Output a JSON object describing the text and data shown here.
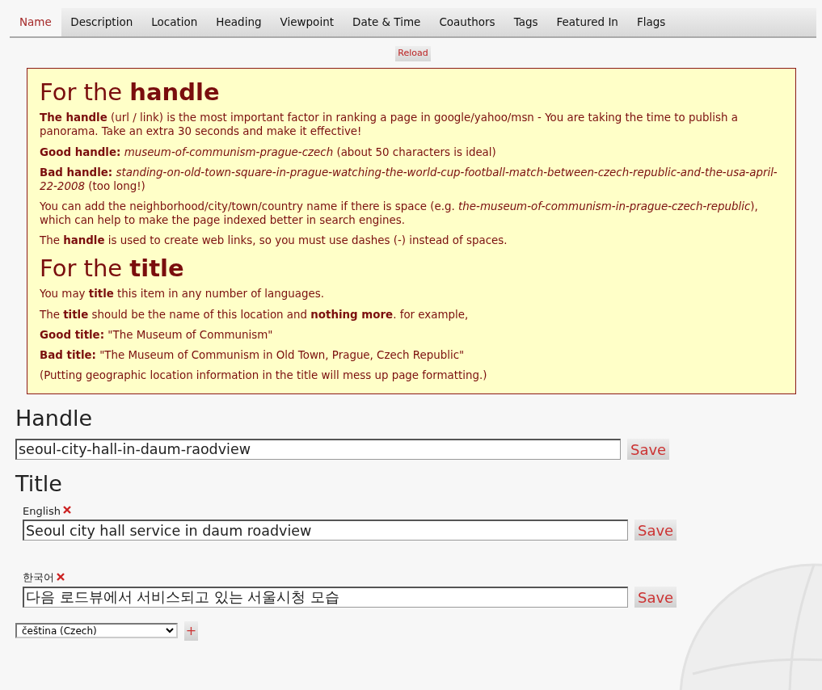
{
  "tabs": [
    {
      "label": "Name",
      "selected": true
    },
    {
      "label": "Description",
      "selected": false
    },
    {
      "label": "Location",
      "selected": false
    },
    {
      "label": "Heading",
      "selected": false
    },
    {
      "label": "Viewpoint",
      "selected": false
    },
    {
      "label": "Date & Time",
      "selected": false
    },
    {
      "label": "Coauthors",
      "selected": false
    },
    {
      "label": "Tags",
      "selected": false
    },
    {
      "label": "Featured In",
      "selected": false
    },
    {
      "label": "Flags",
      "selected": false
    }
  ],
  "reload_button": "Reload",
  "info_box": [
    {
      "kind": "heading",
      "text": "For the **handle**"
    },
    {
      "kind": "paragraph",
      "text": "**The handle** (url / link) is the most important factor in ranking a page in google/yahoo/msn - You are taking the time to publish a panorama. Take an extra 30 seconds and make it effective!"
    },
    {
      "kind": "paragraph",
      "text": "**Good handle:** *museum-of-communism-prague-czech* (about 50 characters is ideal)"
    },
    {
      "kind": "paragraph",
      "text": "**Bad handle:** *standing-on-old-town-square-in-prague-watching-the-world-cup-football-match-between-czech-republic-and-the-usa-april-22-2008* (too long!)"
    },
    {
      "kind": "paragraph",
      "text": "You can add the neighborhood/city/town/country name if there is space (e.g. *the-museum-of-communism-in-prague-czech-republic*), which can help to make the page indexed better in search engines."
    },
    {
      "kind": "paragraph",
      "text": "The **handle** is used to create web links, so you must use dashes (-) instead of spaces."
    },
    {
      "kind": "heading",
      "text": "For the **title**"
    },
    {
      "kind": "paragraph",
      "text": "You may **title** this item in any number of languages."
    },
    {
      "kind": "paragraph",
      "text": "The **title** should be the name of this location and **nothing more**. for example,"
    },
    {
      "kind": "paragraph",
      "text": "**Good title:** \"The Museum of Communism\""
    },
    {
      "kind": "paragraph",
      "text": "**Bad title:** \"The Museum of Communism in Old Town, Prague, Czech Republic\""
    },
    {
      "kind": "paragraph",
      "text": "(Putting geographic location information in the title will mess up page formatting.)"
    }
  ],
  "handle": {
    "heading": "Handle",
    "value": "seoul-city-hall-in-daum-raodview",
    "save": "Save"
  },
  "title": {
    "heading": "Title",
    "languages": [
      {
        "label": "English",
        "value": "Seoul city hall service in daum roadview",
        "save": "Save"
      },
      {
        "label": "한국어",
        "value": "다음 로드뷰에서 서비스되고 있는 서울시청 모습",
        "save": "Save"
      }
    ],
    "language_select": "čeština (Czech)",
    "add_button": "+"
  }
}
